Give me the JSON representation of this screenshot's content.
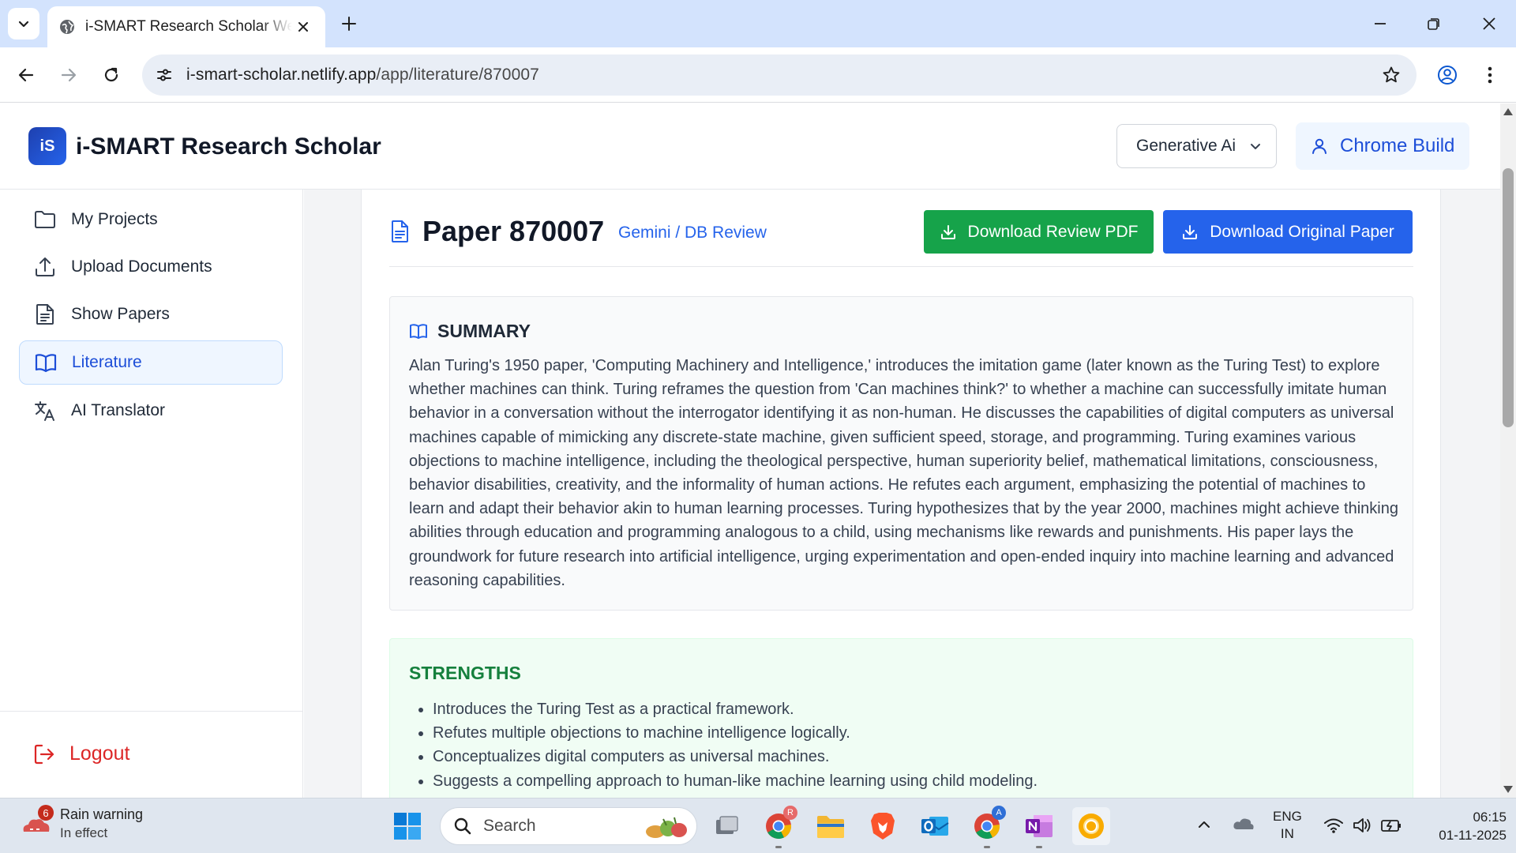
{
  "browser": {
    "tab_title": "i-SMART Research Scholar Web",
    "url_domain": "i-smart-scholar.netlify.app",
    "url_path": "/app/literature/870007"
  },
  "header": {
    "logo_text": "iS",
    "app_title": "i-SMART Research Scholar",
    "model_select_value": "Generative Ai",
    "user_name": "Chrome Build",
    "accent_color": "#2563eb"
  },
  "sidebar": {
    "items": [
      {
        "label": "My Projects",
        "icon": "folder-icon",
        "active": false
      },
      {
        "label": "Upload Documents",
        "icon": "upload-icon",
        "active": false
      },
      {
        "label": "Show Papers",
        "icon": "document-icon",
        "active": false
      },
      {
        "label": "Literature",
        "icon": "book-open-icon",
        "active": true
      },
      {
        "label": "AI Translator",
        "icon": "translate-icon",
        "active": false
      }
    ],
    "logout_label": "Logout"
  },
  "paper": {
    "title": "Paper 870007",
    "source": "Gemini / DB Review",
    "download_review_label": "Download Review PDF",
    "download_original_label": "Download Original Paper",
    "summary_heading": "SUMMARY",
    "summary_text": "Alan Turing's 1950 paper, 'Computing Machinery and Intelligence,' introduces the imitation game (later known as the Turing Test) to explore whether machines can think. Turing reframes the question from 'Can machines think?' to whether a machine can successfully imitate human behavior in a conversation without the interrogator identifying it as non-human. He discusses the capabilities of digital computers as universal machines capable of mimicking any discrete-state machine, given sufficient speed, storage, and programming. Turing examines various objections to machine intelligence, including the theological perspective, human superiority belief, mathematical limitations, consciousness, behavior disabilities, creativity, and the informality of human actions. He refutes each argument, emphasizing the potential of machines to learn and adapt their behavior akin to human learning processes. Turing hypothesizes that by the year 2000, machines might achieve thinking abilities through education and programming analogous to a child, using mechanisms like rewards and punishments. His paper lays the groundwork for future research into artificial intelligence, urging experimentation and open-ended inquiry into machine learning and advanced reasoning capabilities.",
    "strengths_heading": "STRENGTHS",
    "strengths": [
      "Introduces the Turing Test as a practical framework.",
      "Refutes multiple objections to machine intelligence logically.",
      "Conceptualizes digital computers as universal machines.",
      "Suggests a compelling approach to human-like machine learning using child modeling."
    ]
  },
  "taskbar": {
    "weather_badge": "6",
    "weather_line1": "Rain warning",
    "weather_line2": "In effect",
    "search_placeholder": "Search",
    "chrome_badge_r": "R",
    "chrome_badge_a": "A",
    "lang_line1": "ENG",
    "lang_line2": "IN",
    "time": "06:15",
    "date": "01-11-2025"
  }
}
